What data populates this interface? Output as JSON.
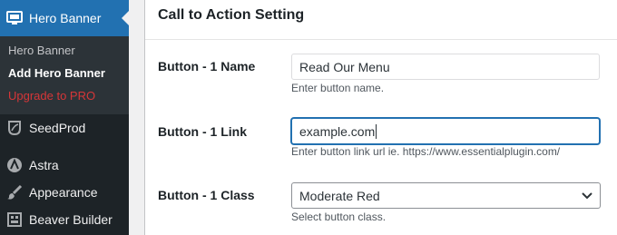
{
  "sidebar": {
    "active_item": {
      "label": "Hero Banner",
      "icon": "desktop-icon"
    },
    "submenu": [
      "Hero Banner",
      "Add Hero Banner",
      "Upgrade to PRO"
    ],
    "items": [
      {
        "label": "SeedProd",
        "icon": "seedprod-leaf-icon"
      },
      {
        "label": "Astra",
        "icon": "astra-logo-icon"
      },
      {
        "label": "Appearance",
        "icon": "paintbrush-icon"
      },
      {
        "label": "Beaver Builder",
        "icon": "beaver-builder-icon"
      }
    ]
  },
  "section": {
    "title": "Call to Action Setting",
    "fields": [
      {
        "label": "Button - 1 Name",
        "value": "Read Our Menu",
        "description": "Enter button name."
      },
      {
        "label": "Button - 1 Link",
        "value": "example.com",
        "description": "Enter button link url ie. https://www.essentialplugin.com/"
      },
      {
        "label": "Button - 1 Class",
        "value": "Moderate Red",
        "description": "Select button class."
      }
    ]
  },
  "colors": {
    "sidebar_bg": "#1d2327",
    "active_bg": "#2271b1",
    "upgrade_text": "#d63638",
    "focus_border": "#2271b1"
  }
}
